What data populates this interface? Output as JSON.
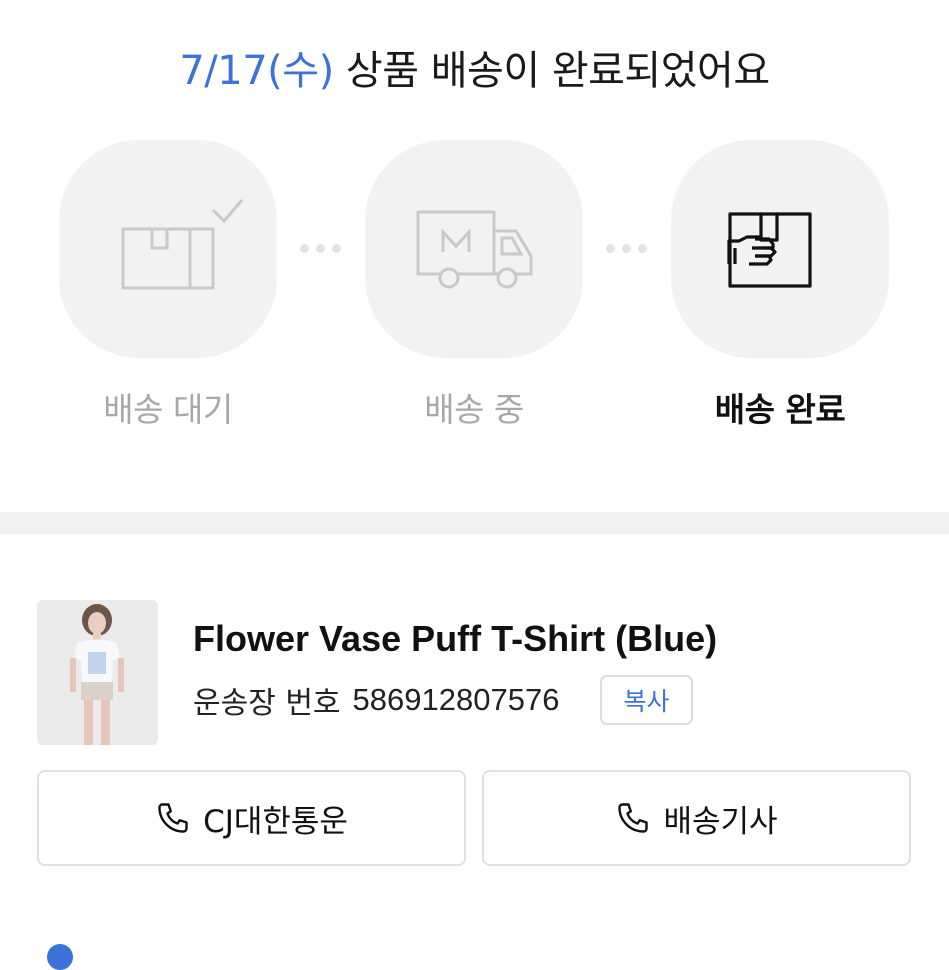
{
  "header": {
    "date": "7/17(수)",
    "message": "상품 배송이 완료되었어요"
  },
  "steps": [
    {
      "label": "배송 대기",
      "icon": "box-check-icon",
      "active": false
    },
    {
      "label": "배송 중",
      "icon": "delivery-truck-icon",
      "active": false
    },
    {
      "label": "배송 완료",
      "icon": "hand-box-icon",
      "active": true
    }
  ],
  "product": {
    "name": "Flower Vase Puff T-Shirt (Blue)",
    "tracking_label": "운송장 번호",
    "tracking_number": "586912807576",
    "copy_label": "복사"
  },
  "actions": {
    "courier_label": "CJ대한통운",
    "driver_label": "배송기사"
  },
  "colors": {
    "accent": "#3b73d9",
    "inactive_text": "#a8a8a8",
    "circle_bg": "#f2f2f2"
  }
}
